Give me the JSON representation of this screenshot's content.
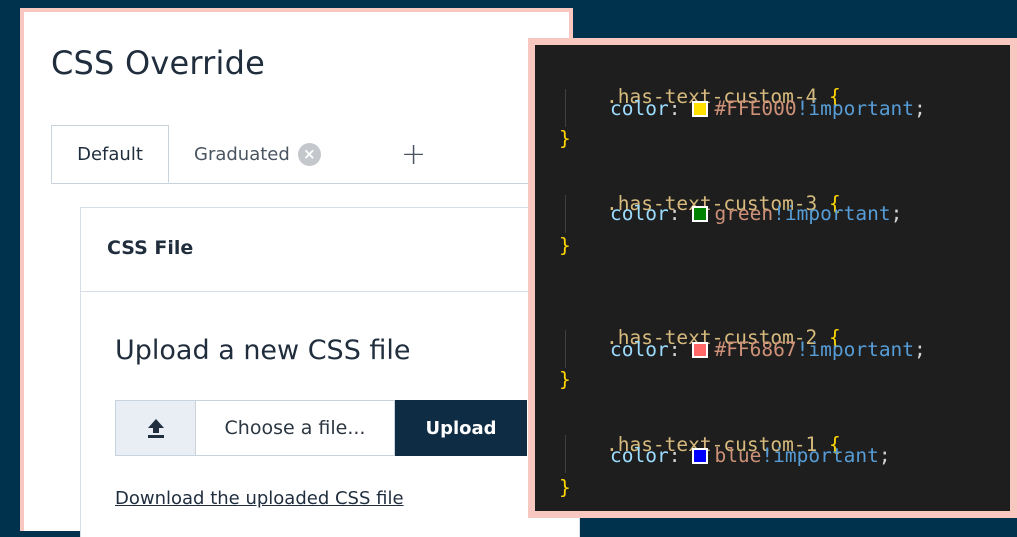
{
  "panel": {
    "title": "CSS Override",
    "tabs": [
      {
        "label": "Default",
        "active": true
      },
      {
        "label": "Graduated",
        "closable": true,
        "close_icon": "×"
      }
    ],
    "add_tab_icon": "+",
    "card": {
      "header": "CSS File",
      "body_title": "Upload a new CSS file",
      "file_placeholder": "Choose a file...",
      "upload_icon": "upload-icon",
      "upload_button": "Upload",
      "download_link": "Download the uploaded CSS file"
    }
  },
  "code": {
    "rules": [
      {
        "selector": ".has-text-custom-4",
        "open": "{",
        "property": "color",
        "colon": ":",
        "swatch": "#FFE000",
        "value": "#FFE000",
        "important": "!important",
        "semicolon": ";",
        "close": "}"
      },
      {
        "selector": ".has-text-custom-3",
        "open": "{",
        "property": "color",
        "colon": ":",
        "swatch": "#008000",
        "value": "green",
        "important": "!important",
        "semicolon": ";",
        "close": "}"
      },
      {
        "selector": ".has-text-custom-2",
        "open": "{",
        "property": "color",
        "colon": ":",
        "swatch": "#FF6867",
        "value": "#FF6867",
        "important": "!important",
        "semicolon": ";",
        "close": "}"
      },
      {
        "selector": ".has-text-custom-1",
        "open": "{",
        "property": "color",
        "colon": ":",
        "swatch": "#0000FF",
        "value": "blue",
        "important": "!important",
        "semicolon": ";",
        "close": "}"
      }
    ]
  },
  "colors": {
    "background": "#00314d",
    "panel_border": "#f7c7c0",
    "upload_button_bg": "#0e2c44"
  }
}
